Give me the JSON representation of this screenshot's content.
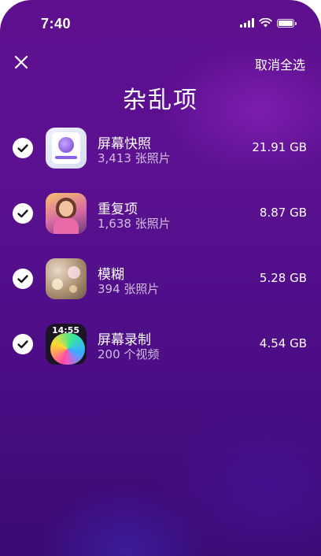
{
  "status_bar": {
    "time": "7:40"
  },
  "header": {
    "close_icon": "close-icon",
    "deselect_all_label": "取消全选",
    "title": "杂乱项"
  },
  "items": [
    {
      "name": "屏幕快照",
      "detail": "3,413 张照片",
      "size": "21.91 GB",
      "checked": true,
      "thumbnail": "screenshot-thumbnail"
    },
    {
      "name": "重复项",
      "detail": "1,638 张照片",
      "size": "8.87 GB",
      "checked": true,
      "thumbnail": "duplicate-photo-thumbnail"
    },
    {
      "name": "模糊",
      "detail": "394 张照片",
      "size": "5.28 GB",
      "checked": true,
      "thumbnail": "blurry-photo-thumbnail"
    },
    {
      "name": "屏幕录制",
      "detail": "200 个视频",
      "size": "4.54 GB",
      "checked": true,
      "thumbnail": "screen-recording-thumbnail"
    }
  ],
  "colors": {
    "background_top": "#5e0f8e",
    "background_bottom": "#3a0a72",
    "text": "#ffffff"
  }
}
